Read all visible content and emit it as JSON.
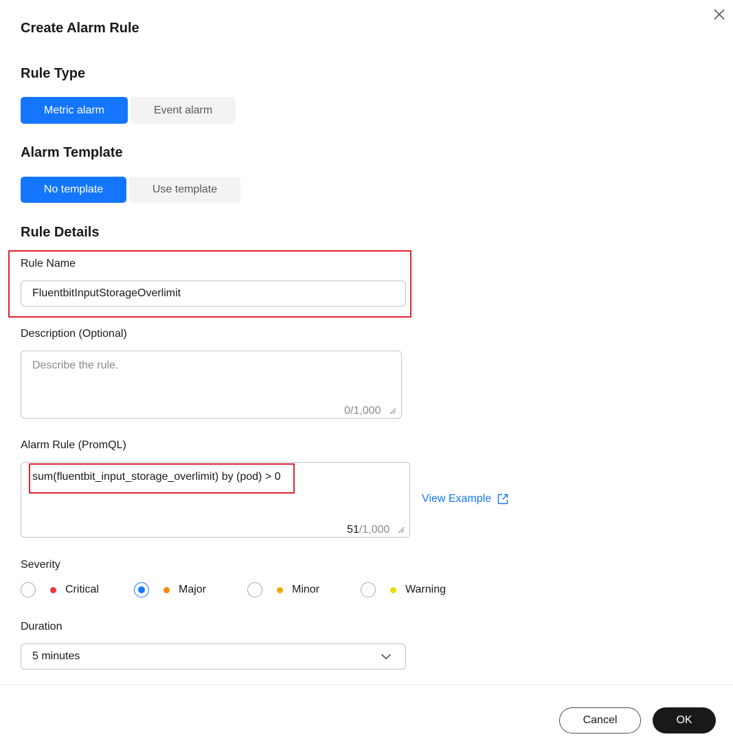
{
  "dialog": {
    "title": "Create Alarm Rule"
  },
  "rule_type": {
    "title": "Rule Type",
    "options": [
      "Metric alarm",
      "Event alarm"
    ],
    "selected": "Metric alarm"
  },
  "alarm_template": {
    "title": "Alarm Template",
    "options": [
      "No template",
      "Use template"
    ],
    "selected": "No template"
  },
  "rule_details": {
    "title": "Rule Details",
    "rule_name": {
      "label": "Rule Name",
      "value": "FluentbitInputStorageOverlimit"
    },
    "description": {
      "label": "Description (Optional)",
      "placeholder": "Describe the rule.",
      "count": "0",
      "max": "/1,000"
    },
    "alarm_rule": {
      "label": "Alarm Rule (PromQL)",
      "value": "sum(fluentbit_input_storage_overlimit) by (pod) > 0",
      "count": "51",
      "max": "/1,000",
      "view_example": "View Example"
    },
    "severity": {
      "label": "Severity",
      "options": [
        {
          "label": "Critical",
          "color": "#e8353e"
        },
        {
          "label": "Major",
          "color": "#f28b0c"
        },
        {
          "label": "Minor",
          "color": "#f5a70f"
        },
        {
          "label": "Warning",
          "color": "#f0d90a"
        }
      ],
      "selected": "Major"
    },
    "duration": {
      "label": "Duration",
      "value": "5 minutes"
    }
  },
  "footer": {
    "cancel": "Cancel",
    "ok": "OK"
  },
  "colors": {
    "accent": "#1476ff",
    "highlight_outline": "#e0242e"
  }
}
